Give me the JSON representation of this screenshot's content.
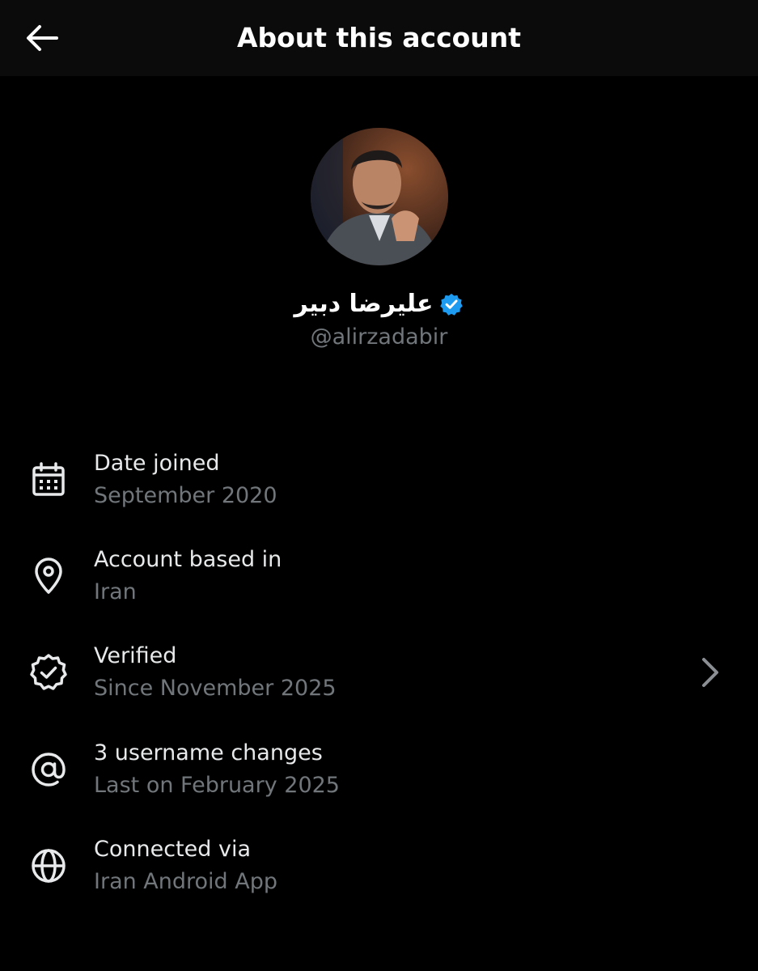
{
  "header": {
    "title": "About this account",
    "back_icon": "arrow-left-icon"
  },
  "profile": {
    "display_name": "علیرضا دبیر",
    "handle": "@alirzadabir",
    "verified_badge_color": "#1d9bf0"
  },
  "details": [
    {
      "icon": "calendar-icon",
      "label": "Date joined",
      "value": "September 2020"
    },
    {
      "icon": "location-pin-icon",
      "label": "Account based in",
      "value": "Iran"
    },
    {
      "icon": "verified-badge-icon",
      "label": "Verified",
      "value": "Since November 2025"
    },
    {
      "icon": "at-sign-icon",
      "label": "3 username changes",
      "value": "Last on February 2025"
    },
    {
      "icon": "globe-icon",
      "label": "Connected via",
      "value": "Iran Android App"
    }
  ],
  "colors": {
    "background": "#000000",
    "primary_text": "#e7e9ea",
    "secondary_text": "#71767b",
    "accent": "#1d9bf0"
  }
}
